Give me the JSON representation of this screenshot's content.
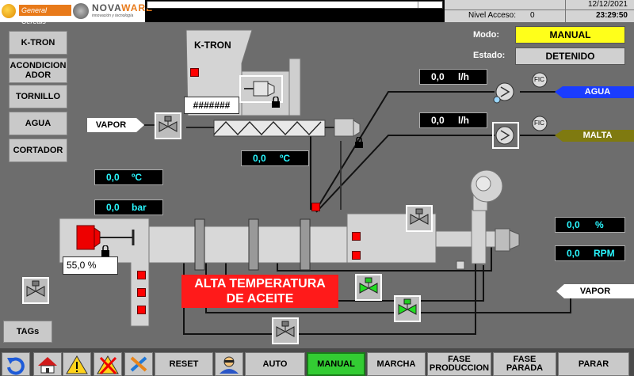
{
  "header": {
    "logo_general": "General Cereals",
    "logo_nova": "NOVA",
    "logo_ware": "WARE",
    "logo_tagline": "innovación y tecnología",
    "date": "12/12/2021",
    "time": "23:29:50",
    "access_label": "Nivel Acceso:",
    "access_value": "0"
  },
  "nav": [
    "K-TRON",
    "ACONDICIONADOR",
    "TORNILLO",
    "AGUA",
    "CORTADOR"
  ],
  "nav_display": [
    "K-TRON",
    "ACONDICION\nADOR",
    "TORNILLO",
    "AGUA",
    "CORTADOR"
  ],
  "tags_button": "TAGs",
  "mode": {
    "label": "Modo:",
    "value": "MANUAL"
  },
  "state": {
    "label": "Estado:",
    "value": "DETENIDO"
  },
  "ktron": {
    "label": "K-TRON",
    "display": "#######"
  },
  "water": {
    "value": "0,0",
    "unit": "l/h",
    "label": "AGUA",
    "fic": "FIC"
  },
  "malt": {
    "value": "0,0",
    "unit": "l/h",
    "label": "MALTA",
    "fic": "FIC"
  },
  "steam_top": "VAPOR",
  "steam_bottom": "VAPOR",
  "temp_screw": {
    "value": "0,0",
    "unit": "ºC"
  },
  "temp_left": {
    "value": "0,0",
    "unit": "ºC"
  },
  "pressure": {
    "value": "0,0",
    "unit": "bar"
  },
  "percent_left": {
    "value": "55,0",
    "unit": "%"
  },
  "percent_right": {
    "value": "0,0",
    "unit": "%"
  },
  "rpm": {
    "value": "0,0",
    "unit": "RPM"
  },
  "alarm": {
    "line1": "ALTA TEMPERATURA",
    "line2": "DE ACEITE"
  },
  "bottom": {
    "reset": "RESET",
    "auto": "AUTO",
    "manual": "MANUAL",
    "marcha": "MARCHA",
    "fase_prod": "FASE\nPRODUCCION",
    "fase_parada": "FASE\nPARADA",
    "parar": "PARAR"
  },
  "colors": {
    "water": "#1a3cff",
    "malt": "#7f7a10",
    "manual_active": "#33cc33",
    "mode": "#ffff1a",
    "alarm": "#ff1a1a"
  }
}
